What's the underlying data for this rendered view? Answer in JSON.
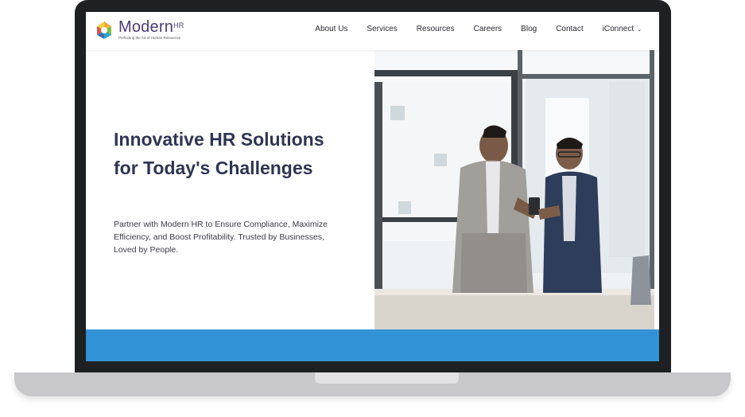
{
  "header": {
    "logo_name": "Modern",
    "logo_superscript": "HR",
    "logo_tagline": "Perfecting the Art of Human Resources",
    "nav": [
      {
        "label": "About Us"
      },
      {
        "label": "Services"
      },
      {
        "label": "Resources"
      },
      {
        "label": "Careers"
      },
      {
        "label": "Blog"
      },
      {
        "label": "Contact"
      },
      {
        "label": "iConnect",
        "dropdown": true
      }
    ]
  },
  "hero": {
    "title": "Innovative HR Solutions for Today's Challenges",
    "text": "Partner with Modern HR to Ensure Compliance, Maximize Efficiency, and Boost Profitability. Trusted by Businesses, Loved by People.",
    "image": "two-businessmen-looking-at-phone-photo"
  },
  "colors": {
    "brand_purple": "#4a3d78",
    "heading": "#2f3553",
    "accent_blue": "#3193d6",
    "laptop_frame": "#1f2022"
  }
}
